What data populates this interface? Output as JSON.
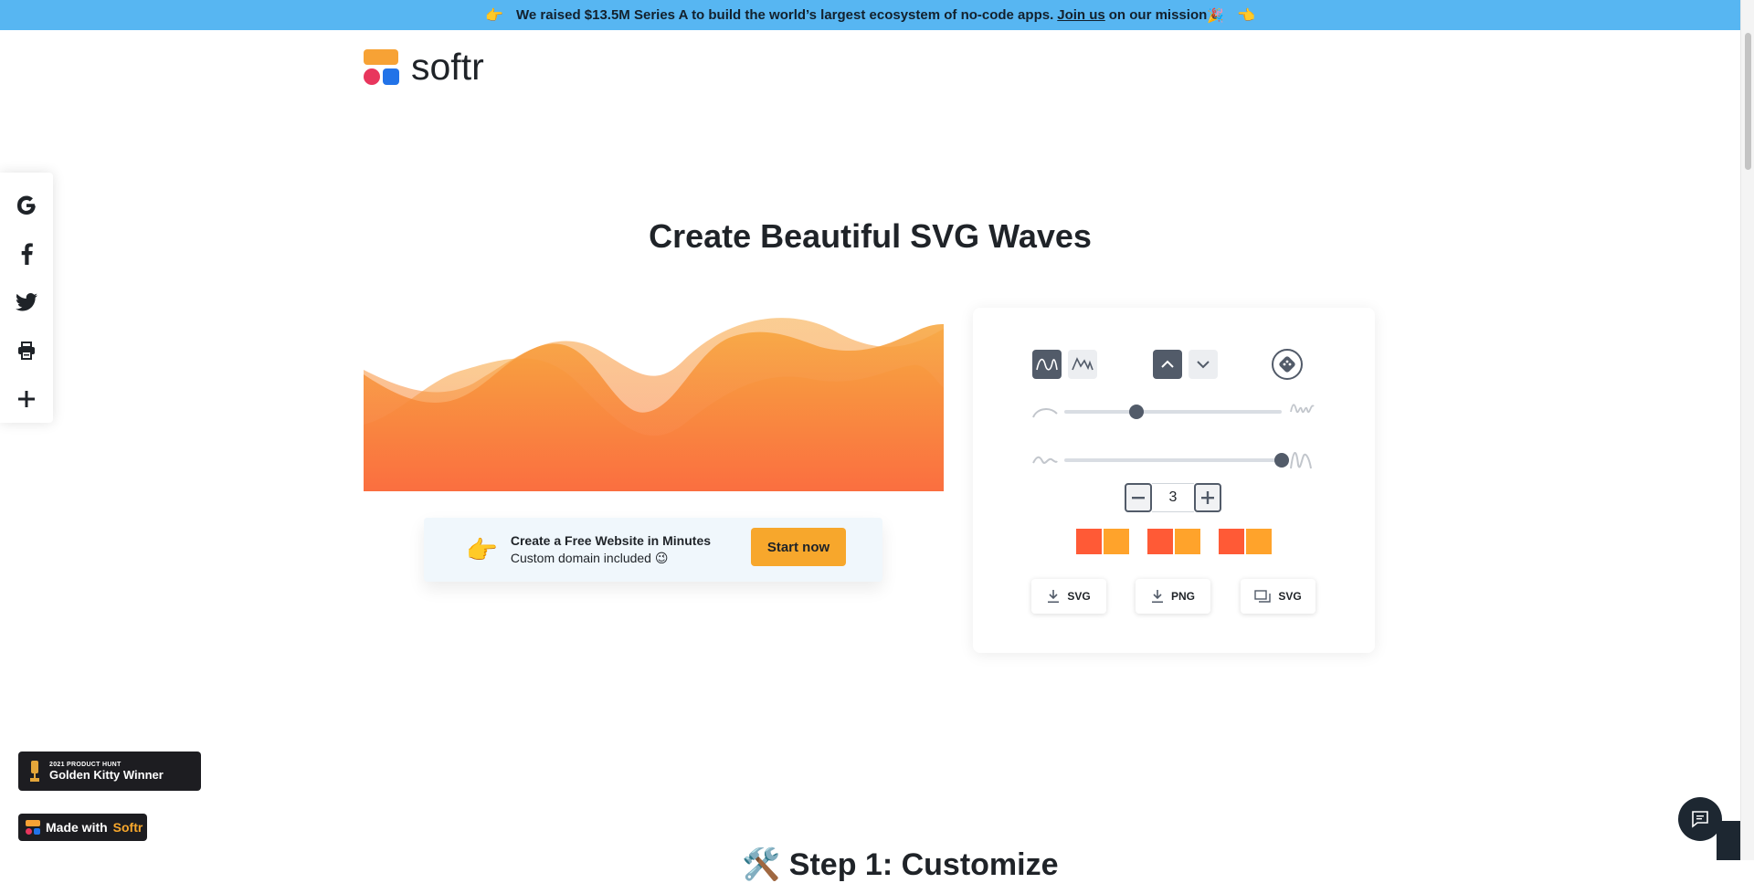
{
  "announcement": {
    "lead_emoji": "👉",
    "text": "We raised $13.5M Series A to build the world’s largest ecosystem of no-code apps.",
    "link": "Join us",
    "tail": "on our mission",
    "party_emoji": "🎉",
    "trail_emoji": "👈"
  },
  "brand": {
    "name": "softr"
  },
  "share": [
    "google-icon",
    "facebook-icon",
    "twitter-icon",
    "print-icon",
    "plus-icon"
  ],
  "page": {
    "title": "Create Beautiful SVG Waves"
  },
  "colors": {
    "wave_top": "#f7a53a",
    "wave_bottom": "#fa6a3a",
    "accent": "#f7a72c",
    "control": "#525b69"
  },
  "promo": {
    "emoji": "👉",
    "heading": "Create a Free Website in Minutes",
    "subtext": "Custom domain included 😉",
    "button": "Start now"
  },
  "controls": {
    "type_options": [
      "smooth-wave-icon",
      "peak-wave-icon"
    ],
    "direction_options": [
      "chevron-up-icon",
      "chevron-down-icon"
    ],
    "randomize": "dice-icon",
    "complexity_fraction": 0.33,
    "height_fraction": 1.0,
    "layers": "3",
    "swatches": [
      [
        "#ff5a36",
        "#ffa32b"
      ],
      [
        "#ff5a36",
        "#ffa32b"
      ],
      [
        "#ff5a36",
        "#ffa32b"
      ]
    ],
    "downloads": [
      {
        "icon": "download-icon",
        "label": "SVG"
      },
      {
        "icon": "download-icon",
        "label": "PNG"
      },
      {
        "icon": "copy-icon",
        "label": "SVG"
      }
    ]
  },
  "badges": {
    "kitty_small": "2021 PRODUCT HUNT",
    "kitty_big": "Golden Kitty Winner",
    "made_with": "Made with",
    "made_brand": "Softr"
  },
  "section2": {
    "title": "🛠️ Step 1: Customize"
  }
}
